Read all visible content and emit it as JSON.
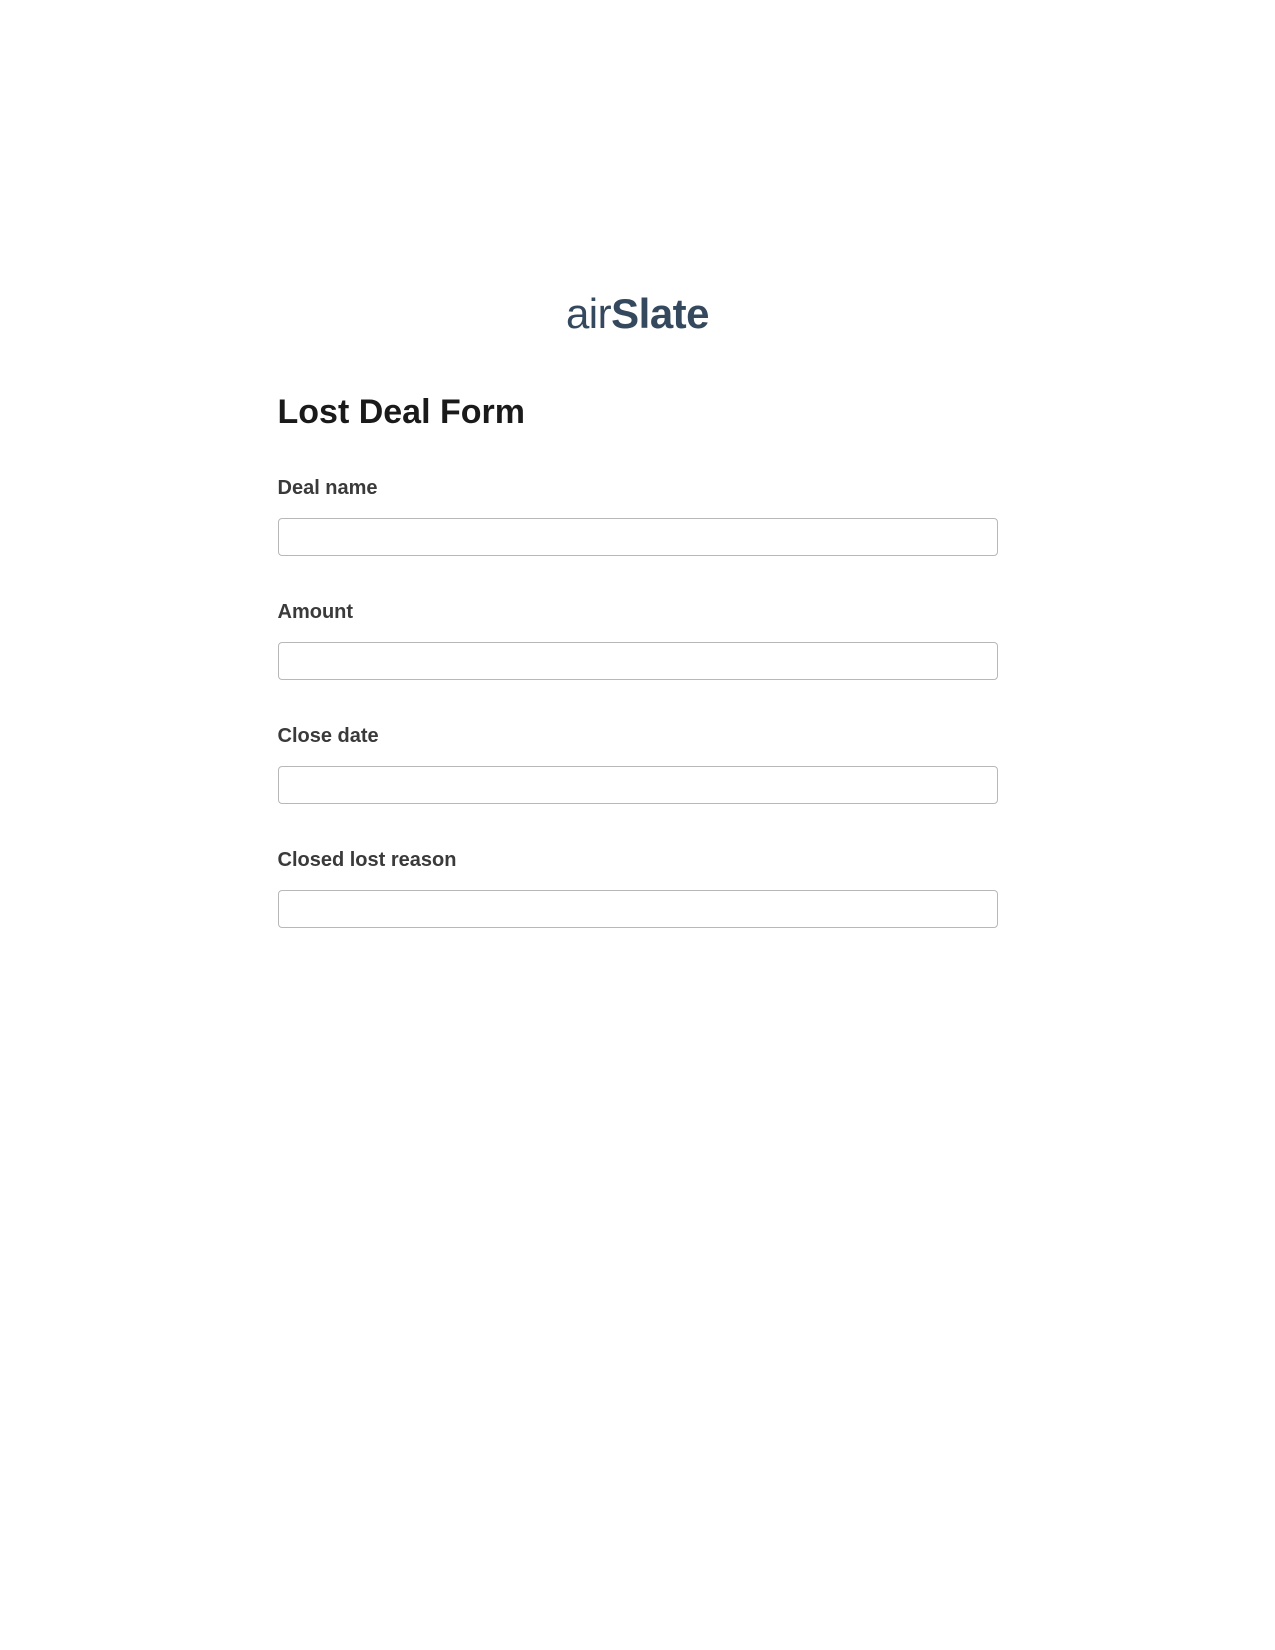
{
  "logo": {
    "prefix": "air",
    "suffix": "Slate"
  },
  "form": {
    "title": "Lost Deal Form",
    "fields": [
      {
        "label": "Deal name",
        "value": ""
      },
      {
        "label": "Amount",
        "value": ""
      },
      {
        "label": "Close date",
        "value": ""
      },
      {
        "label": "Closed lost reason",
        "value": ""
      }
    ]
  }
}
